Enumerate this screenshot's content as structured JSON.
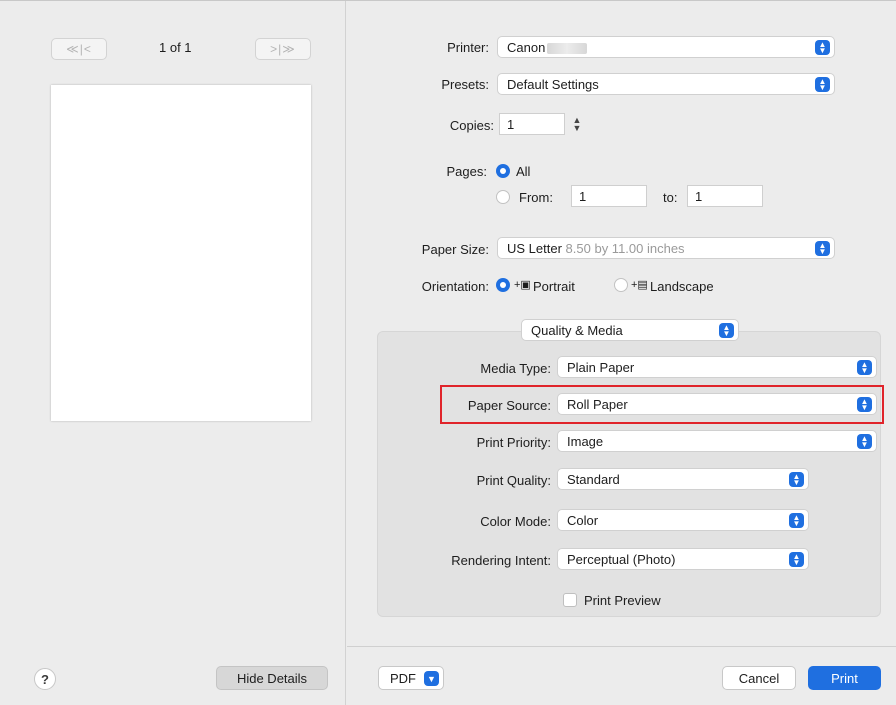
{
  "preview": {
    "first_prev_label": "≪|<",
    "page_count": "1 of 1",
    "next_last_label": ">|≫",
    "help_label": "?",
    "hide_details_label": "Hide Details"
  },
  "printer": {
    "label": "Printer:",
    "value": "Canon"
  },
  "presets": {
    "label": "Presets:",
    "value": "Default Settings"
  },
  "copies": {
    "label": "Copies:",
    "value": "1"
  },
  "pages": {
    "label": "Pages:",
    "all_label": "All",
    "from_label": "From:",
    "from_value": "1",
    "to_label": "to:",
    "to_value": "1",
    "selected": "All"
  },
  "paper_size": {
    "label": "Paper Size:",
    "value": "US Letter",
    "detail": "8.50 by 11.00 inches"
  },
  "orientation": {
    "label": "Orientation:",
    "portrait_label": "Portrait",
    "landscape_label": "Landscape",
    "selected": "Portrait"
  },
  "panel": {
    "value": "Quality & Media"
  },
  "quality_media": {
    "media_type": {
      "label": "Media Type:",
      "value": "Plain Paper"
    },
    "paper_source": {
      "label": "Paper Source:",
      "value": "Roll Paper"
    },
    "print_priority": {
      "label": "Print Priority:",
      "value": "Image"
    },
    "print_quality": {
      "label": "Print Quality:",
      "value": "Standard"
    },
    "color_mode": {
      "label": "Color Mode:",
      "value": "Color"
    },
    "rendering_intent": {
      "label": "Rendering Intent:",
      "value": "Perceptual (Photo)"
    },
    "print_preview": {
      "label": "Print Preview",
      "checked": false
    }
  },
  "footer": {
    "pdf_label": "PDF",
    "cancel_label": "Cancel",
    "print_label": "Print"
  },
  "colors": {
    "accent": "#1f6fe0",
    "highlight": "#e0242b",
    "background": "#ececec"
  }
}
